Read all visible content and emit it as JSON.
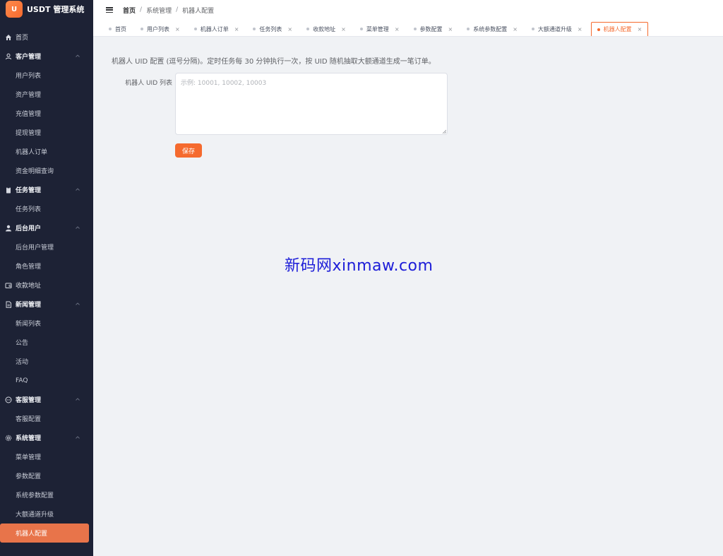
{
  "app": {
    "logo_letter": "U",
    "title": "USDT 管理系统"
  },
  "breadcrumb": [
    "首页",
    "系统管理",
    "机器人配置"
  ],
  "sidebar": {
    "items": [
      {
        "type": "single",
        "label": "首页",
        "icon": "home-icon"
      },
      {
        "type": "group",
        "label": "客户管理",
        "icon": "user-icon"
      },
      {
        "type": "sub",
        "label": "用户列表"
      },
      {
        "type": "sub",
        "label": "资产管理"
      },
      {
        "type": "sub",
        "label": "充值管理"
      },
      {
        "type": "sub",
        "label": "提现管理"
      },
      {
        "type": "sub",
        "label": "机器人订单"
      },
      {
        "type": "sub",
        "label": "资金明细查询"
      },
      {
        "type": "group",
        "label": "任务管理",
        "icon": "clipboard-icon"
      },
      {
        "type": "sub",
        "label": "任务列表"
      },
      {
        "type": "group",
        "label": "后台用户",
        "icon": "person-icon"
      },
      {
        "type": "sub",
        "label": "后台用户管理"
      },
      {
        "type": "sub",
        "label": "角色管理"
      },
      {
        "type": "single",
        "label": "收款地址",
        "icon": "wallet-icon"
      },
      {
        "type": "group",
        "label": "新闻管理",
        "icon": "document-icon"
      },
      {
        "type": "sub",
        "label": "新闻列表"
      },
      {
        "type": "sub",
        "label": "公告"
      },
      {
        "type": "sub",
        "label": "活动"
      },
      {
        "type": "sub",
        "label": "FAQ"
      },
      {
        "type": "group",
        "label": "客服管理",
        "icon": "chat-icon"
      },
      {
        "type": "sub",
        "label": "客服配置"
      },
      {
        "type": "group",
        "label": "系统管理",
        "icon": "gear-icon"
      },
      {
        "type": "sub",
        "label": "菜单管理"
      },
      {
        "type": "sub",
        "label": "参数配置"
      },
      {
        "type": "sub",
        "label": "系统参数配置"
      },
      {
        "type": "sub",
        "label": "大额通道升级"
      },
      {
        "type": "sub",
        "label": "机器人配置",
        "active": true
      }
    ]
  },
  "tabs": [
    {
      "label": "首页",
      "closable": false
    },
    {
      "label": "用户列表",
      "closable": true
    },
    {
      "label": "机器人订单",
      "closable": true
    },
    {
      "label": "任务列表",
      "closable": true
    },
    {
      "label": "收款地址",
      "closable": true
    },
    {
      "label": "菜单管理",
      "closable": true
    },
    {
      "label": "参数配置",
      "closable": true
    },
    {
      "label": "系统参数配置",
      "closable": true
    },
    {
      "label": "大额通道升级",
      "closable": true
    },
    {
      "label": "机器人配置",
      "closable": true,
      "active": true
    }
  ],
  "form": {
    "description": "机器人 UID 配置 (逗号分隔)。定时任务每 30 分钟执行一次，按 UID 随机抽取大额通道生成一笔订单。",
    "uid_label": "机器人 UID 列表",
    "uid_value": "",
    "uid_placeholder": "示例: 10001, 10002, 10003",
    "save_label": "保存"
  },
  "watermark": "新码网xinmaw.com",
  "colors": {
    "accent": "#f56a2e",
    "sidebar_bg": "#1d2235",
    "active_item": "#e8744a"
  }
}
